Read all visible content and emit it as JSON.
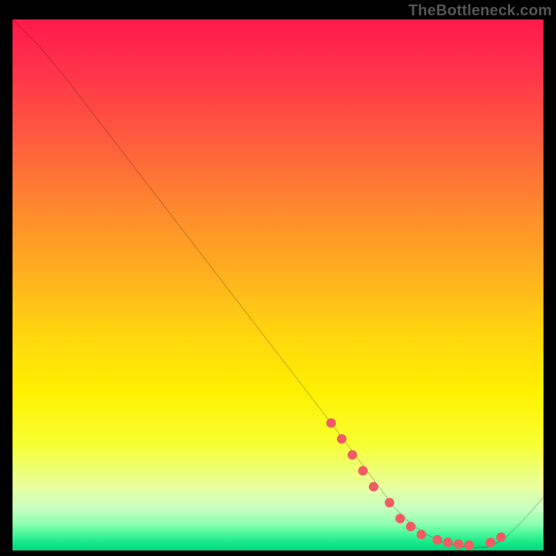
{
  "watermark": "TheBottleneck.com",
  "chart_data": {
    "type": "line",
    "title": "",
    "xlabel": "",
    "ylabel": "",
    "ylim": [
      0,
      100
    ],
    "xlim": [
      0,
      100
    ],
    "x": [
      0,
      5,
      10,
      15,
      20,
      25,
      30,
      35,
      40,
      45,
      50,
      55,
      60,
      63,
      66,
      69,
      72,
      75,
      78,
      81,
      84,
      87,
      90,
      93,
      96,
      100
    ],
    "values": [
      100,
      95,
      89,
      82.5,
      76,
      69.5,
      63,
      56.5,
      50,
      43.5,
      37,
      30.5,
      24,
      20,
      16,
      12,
      8,
      5,
      3,
      1.5,
      0.8,
      0.5,
      0.7,
      2.5,
      5.5,
      10
    ],
    "markers": {
      "x": [
        60,
        62,
        64,
        66,
        68,
        71,
        73,
        75,
        77,
        80,
        82,
        84,
        86,
        90,
        92
      ],
      "values": [
        24,
        21,
        18,
        15,
        12,
        9,
        6,
        4.5,
        3,
        2,
        1.5,
        1.2,
        1,
        1.5,
        2.5
      ]
    },
    "background_gradient": {
      "top": "#ff1a4b",
      "mid": "#fff000",
      "bottom": "#00d97c"
    }
  }
}
